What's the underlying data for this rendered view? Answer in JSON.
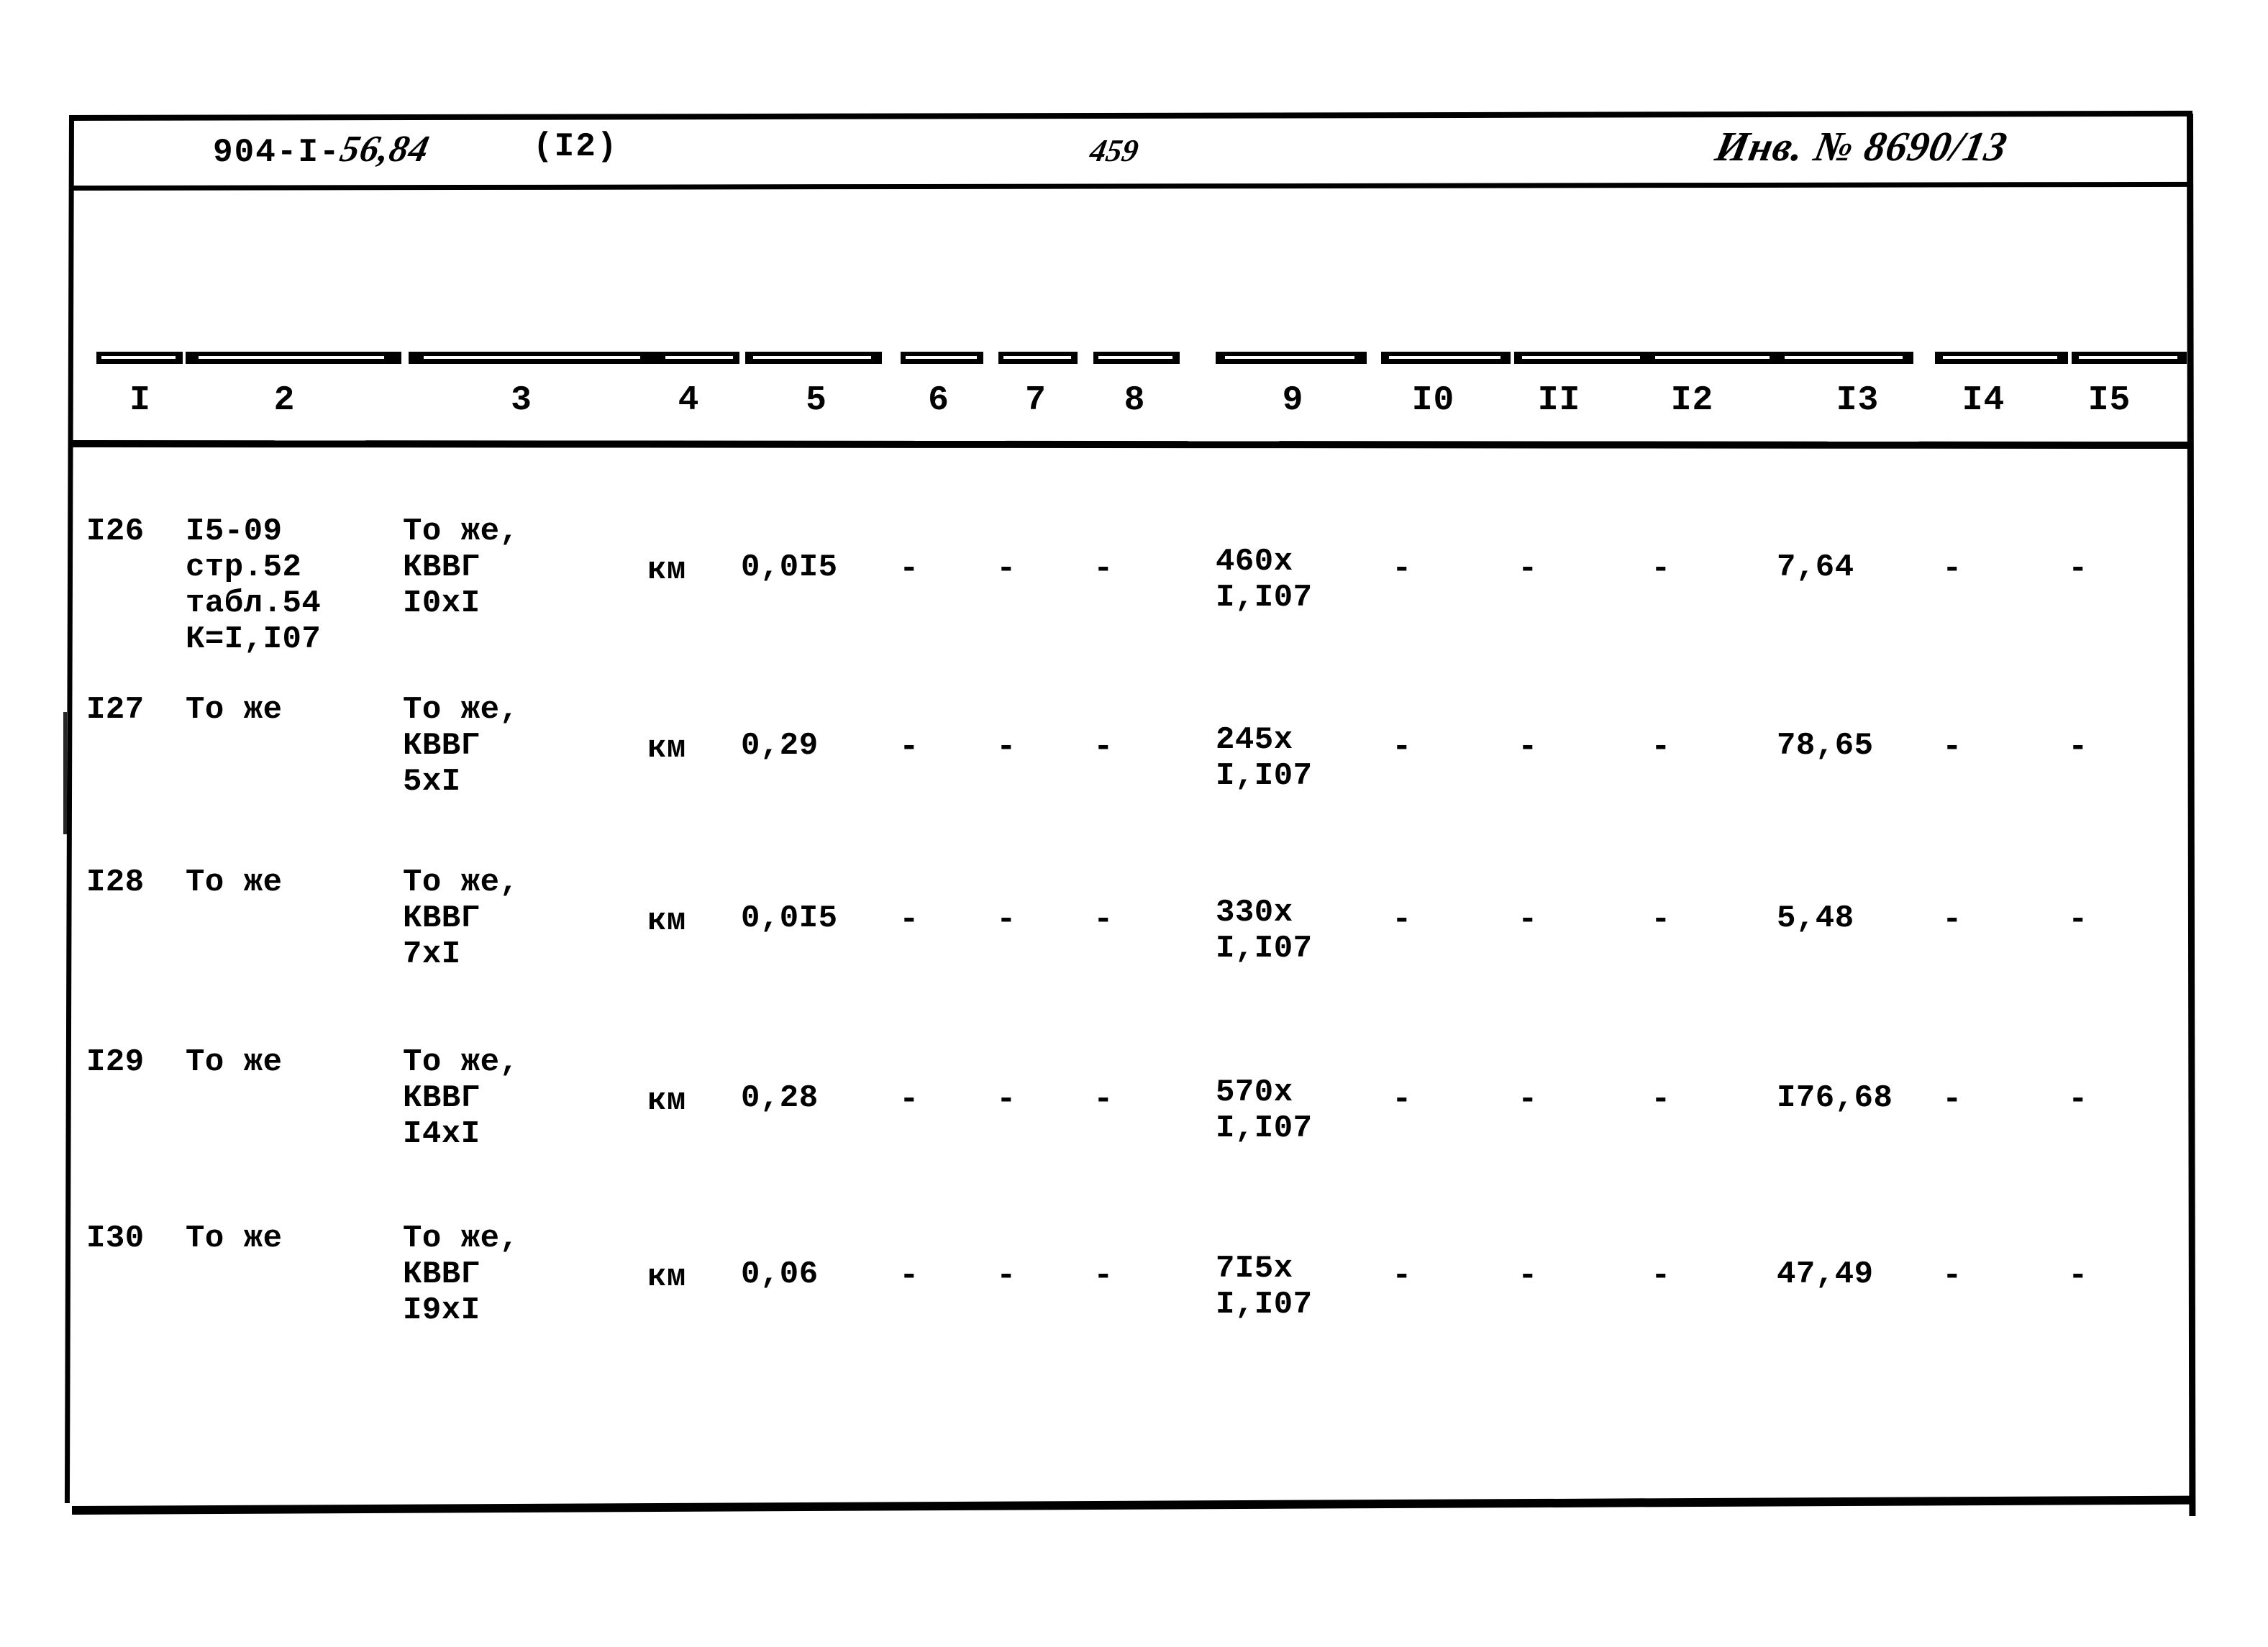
{
  "stamp": {
    "doc_code_prefix": "904-I-",
    "doc_code_hand": "56,84",
    "doc_series": "(I2)",
    "page_number": "459",
    "inventory": "Инв. № 8690/13"
  },
  "table": {
    "column_numbers": [
      "I",
      "2",
      "3",
      "4",
      "5",
      "6",
      "7",
      "8",
      "9",
      "I0",
      "II",
      "I2",
      "I3",
      "I4",
      "I5"
    ],
    "rows": [
      {
        "c1": "I26",
        "c2": [
          "I5-09",
          "стр.52",
          "табл.54",
          "К=I,I07"
        ],
        "c3": [
          "То же,",
          "КВВГ",
          "I0xI"
        ],
        "c4": "км",
        "c5": "0,0I5",
        "c6": "-",
        "c7": "-",
        "c8": "-",
        "c9": [
          "460х",
          "I,I07"
        ],
        "c10": "-",
        "c11": "-",
        "c12": "-",
        "c13": "7,64",
        "c14": "-",
        "c15": "-"
      },
      {
        "c1": "I27",
        "c2": [
          "То же"
        ],
        "c3": [
          "То же,",
          "КВВГ",
          "5xI"
        ],
        "c4": "км",
        "c5": "0,29",
        "c6": "-",
        "c7": "-",
        "c8": "-",
        "c9": [
          "245х",
          "I,I07"
        ],
        "c10": "-",
        "c11": "-",
        "c12": "-",
        "c13": "78,65",
        "c14": "-",
        "c15": "-"
      },
      {
        "c1": "I28",
        "c2": [
          "То же"
        ],
        "c3": [
          "То же,",
          "КВВГ",
          "7xI"
        ],
        "c4": "км",
        "c5": "0,0I5",
        "c6": "-",
        "c7": "-",
        "c8": "-",
        "c9": [
          "330х",
          "I,I07"
        ],
        "c10": "-",
        "c11": "-",
        "c12": "-",
        "c13": "5,48",
        "c14": "-",
        "c15": "-"
      },
      {
        "c1": "I29",
        "c2": [
          "То же"
        ],
        "c3": [
          "То же,",
          "КВВГ",
          "I4xI"
        ],
        "c4": "км",
        "c5": "0,28",
        "c6": "-",
        "c7": "-",
        "c8": "-",
        "c9": [
          "570х",
          "I,I07"
        ],
        "c10": "-",
        "c11": "-",
        "c12": "-",
        "c13": "I76,68",
        "c14": "-",
        "c15": "-"
      },
      {
        "c1": "I30",
        "c2": [
          "То же"
        ],
        "c3": [
          "То же,",
          "КВВГ",
          "I9xI"
        ],
        "c4": "км",
        "c5": "0,06",
        "c6": "-",
        "c7": "-",
        "c8": "-",
        "c9": [
          "7I5х",
          "I,I07"
        ],
        "c10": "-",
        "c11": "-",
        "c12": "-",
        "c13": "47,49",
        "c14": "-",
        "c15": "-"
      }
    ]
  }
}
